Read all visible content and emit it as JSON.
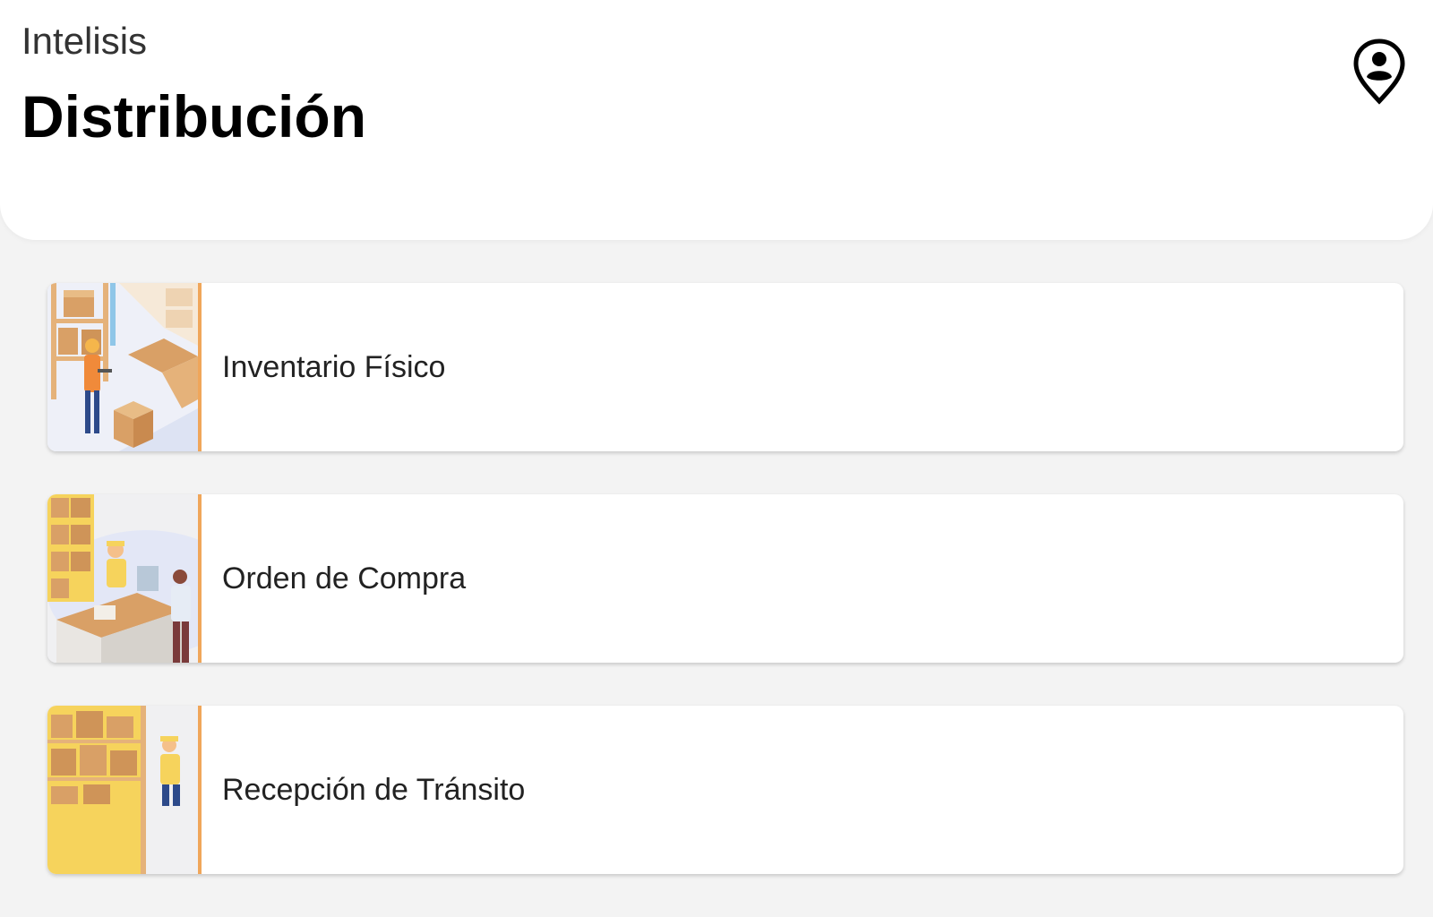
{
  "header": {
    "company": "Intelisis",
    "title": "Distribución",
    "location_icon": "location-person-icon"
  },
  "menu": {
    "items": [
      {
        "label": "Inventario Físico",
        "illustration": "warehouse-inventory-illustration"
      },
      {
        "label": "Orden de Compra",
        "illustration": "purchase-counter-illustration"
      },
      {
        "label": "Recepción de Tránsito",
        "illustration": "transit-reception-illustration"
      }
    ]
  },
  "colors": {
    "background": "#f3f3f3",
    "card_accent": "#f0a65a",
    "box_brown": "#d9a066",
    "text": "#222222"
  }
}
